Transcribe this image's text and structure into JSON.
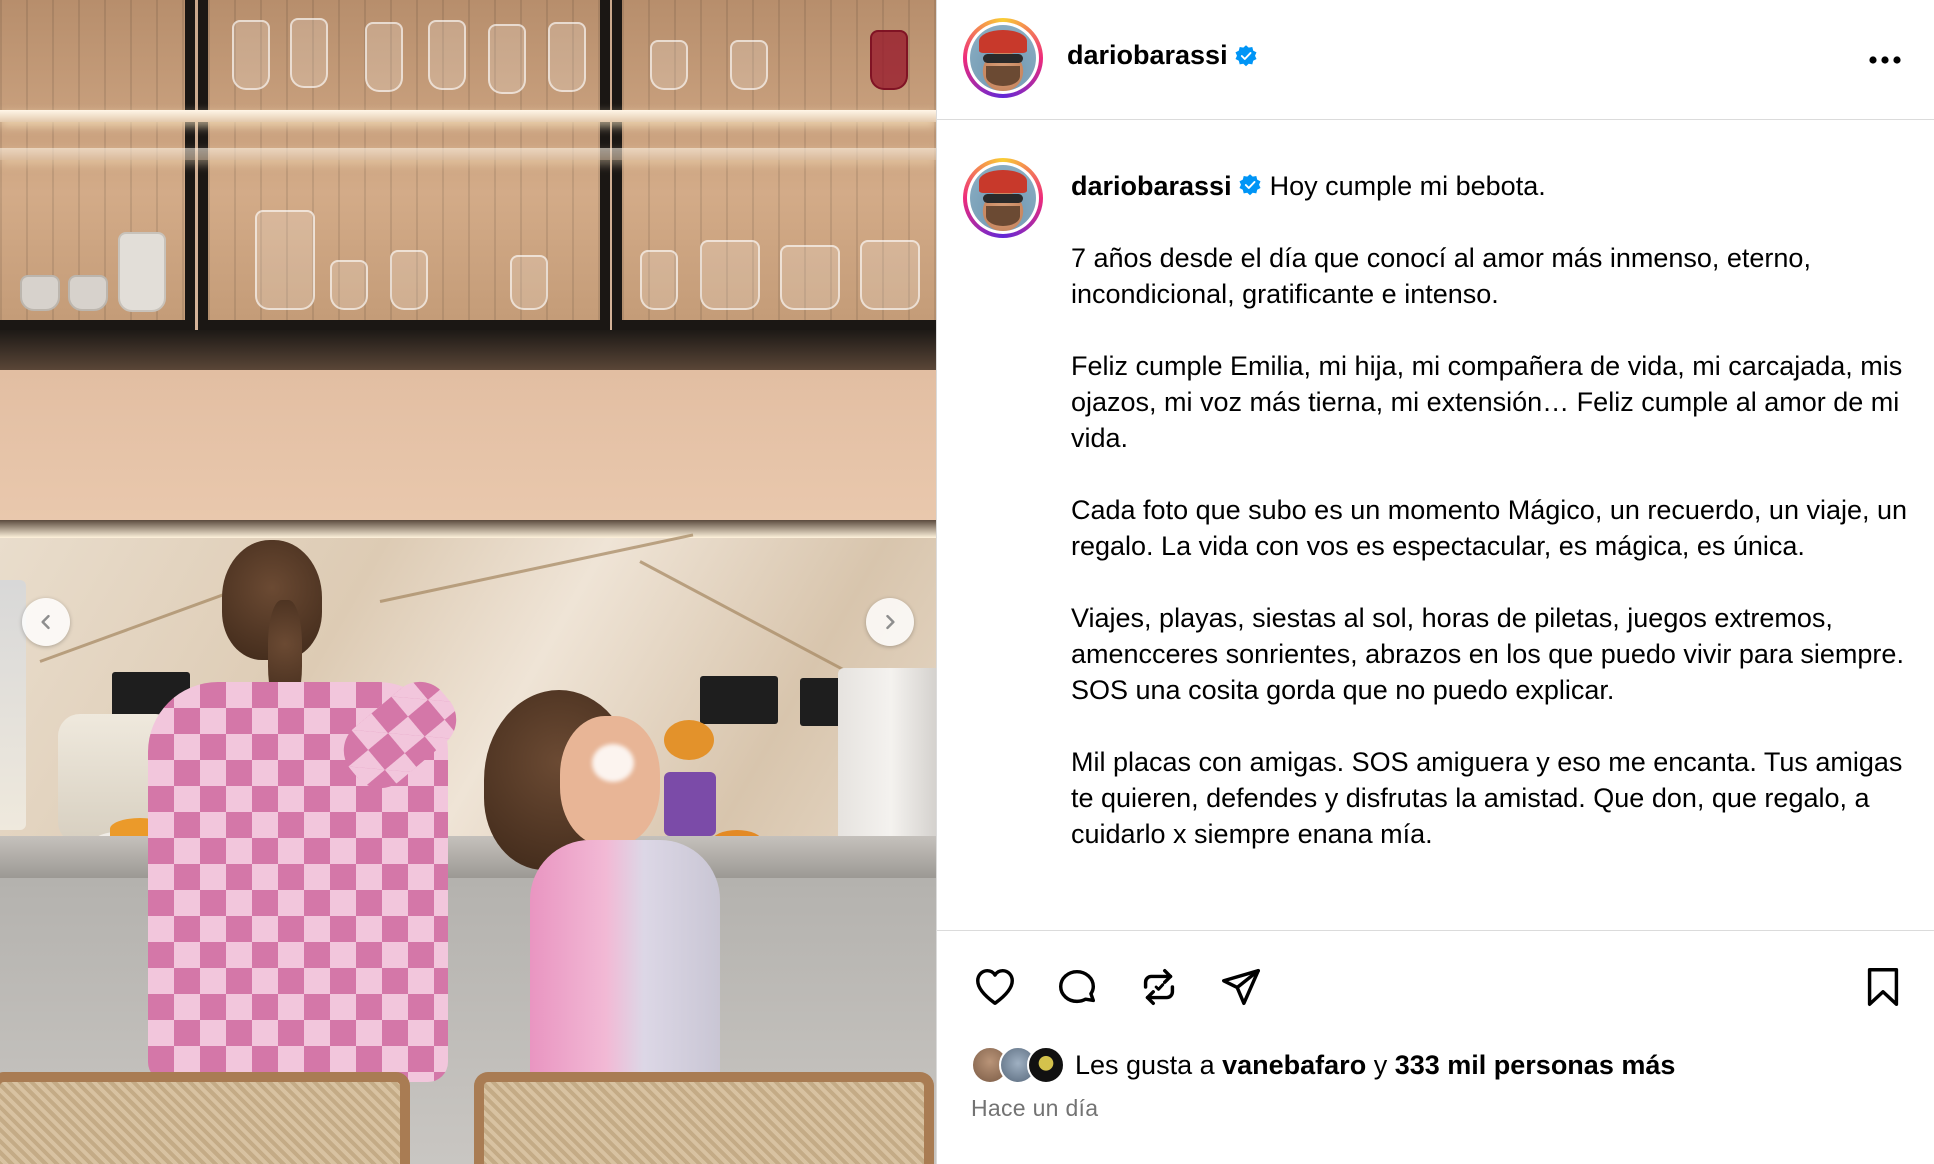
{
  "post": {
    "author": "dariobarassi",
    "verified": true,
    "caption_paragraphs": [
      "Hoy cumple mi bebota.",
      "7 años desde el día que conocí al amor más inmenso, eterno, incondicional, gratificante e intenso.",
      "Feliz cumple Emilia, mi hija, mi compañera de vida, mi carcajada, mis ojazos, mi voz más tierna, mi extensión… Feliz cumple al amor de mi vida.",
      "Cada foto que subo es un momento Mágico, un recuerdo, un viaje, un regalo. La vida con vos es espectacular, es mágica, es única.",
      "Viajes, playas, siestas al sol, horas de piletas, juegos extremos, amencceres sonrientes, abrazos en los que puedo vivir para siempre. SOS una cosita gorda que no puedo explicar.",
      "Mil placas con amigas. SOS amiguera y eso me encanta. Tus amigas te quieren, defendes y disfrutas la amistad. Que don, que regalo, a cuidarlo x siempre enana mía."
    ],
    "likes": {
      "prefix": "Les gusta a",
      "user": "vanebafaro",
      "connector": "y",
      "others": "333 mil personas más"
    },
    "time_ago": "Hace un día"
  },
  "icons": {
    "verified": "verified-badge-icon",
    "more": "more-options-icon",
    "prev": "chevron-left-icon",
    "next": "chevron-right-icon",
    "like": "heart-icon",
    "comment": "comment-icon",
    "repost": "repost-icon",
    "share": "send-icon",
    "save": "bookmark-icon"
  },
  "colors": {
    "verified_blue": "#0095f6",
    "border": "#dbdbdb",
    "muted_text": "#737373"
  }
}
